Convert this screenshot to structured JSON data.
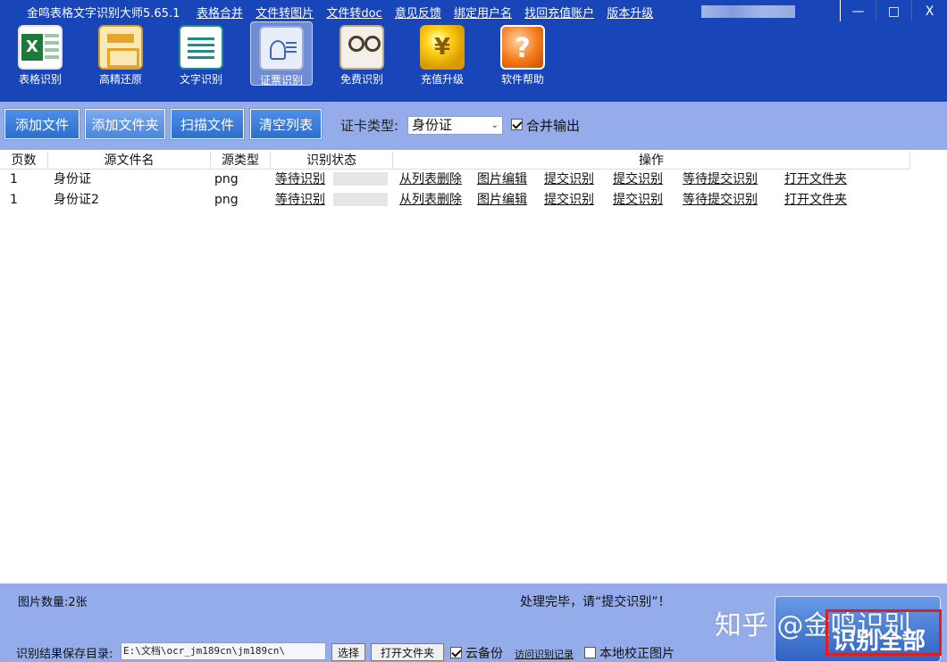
{
  "titlebar": {
    "app_title": "金鸣表格文字识别大师5.65.1",
    "links": [
      "表格合并",
      "文件转图片",
      "文件转doc",
      "意见反馈",
      "绑定用户名",
      "找回充值账户",
      "版本升级"
    ],
    "minimize": "—",
    "maximize": "□",
    "close": "X"
  },
  "toolbar": {
    "tools": [
      {
        "label": "表格识别",
        "icon": "excel-icon"
      },
      {
        "label": "高精还原",
        "icon": "restore-icon"
      },
      {
        "label": "文字识别",
        "icon": "document-icon"
      },
      {
        "label": "证票识别",
        "icon": "id-card-icon",
        "active": true
      },
      {
        "label": "免费识别",
        "icon": "glasses-book-icon"
      },
      {
        "label": "充值升级",
        "icon": "yen-coin-icon",
        "glyph": "¥"
      },
      {
        "label": "软件帮助",
        "icon": "help-icon",
        "glyph": "?"
      }
    ]
  },
  "actions": {
    "add_file": "添加文件",
    "add_folder": "添加文件夹",
    "scan_file": "扫描文件",
    "clear_list": "清空列表",
    "card_type_label": "证卡类型:",
    "card_type_value": "身份证",
    "merge_output": "合并输出",
    "merge_checked": true
  },
  "table": {
    "headers": {
      "pages": "页数",
      "filename": "源文件名",
      "type": "源类型",
      "status": "识别状态",
      "ops": "操作"
    },
    "rows": [
      {
        "pages": "1",
        "filename": "身份证",
        "type": "png",
        "status": "等待识别",
        "ops": [
          "从列表删除",
          "图片编辑",
          "提交识别",
          "提交识别",
          "等待提交识别",
          "打开文件夹"
        ]
      },
      {
        "pages": "1",
        "filename": "身份证2",
        "type": "png",
        "status": "等待识别",
        "ops": [
          "从列表删除",
          "图片编辑",
          "提交识别",
          "提交识别",
          "等待提交识别",
          "打开文件夹"
        ]
      }
    ]
  },
  "bottom": {
    "image_count": "图片数量:2张",
    "done_message": "处理完毕，请“提交识别”！",
    "save_dir_label": "识别结果保存目录:",
    "save_dir_value": "E:\\文档\\ocr_jm189cn\\jm189cn\\",
    "choose": "选择",
    "open_folder": "打开文件夹",
    "cloud_backup": "云备份",
    "visit_records": "访问识别记录",
    "local_correct": "本地校正图片",
    "recognize_all": "识别全部",
    "watermark": "知乎 @金鸣识别"
  },
  "colors": {
    "titlebar": "#1845b8",
    "panel": "#94adea",
    "highlight": "#e11d1d"
  }
}
